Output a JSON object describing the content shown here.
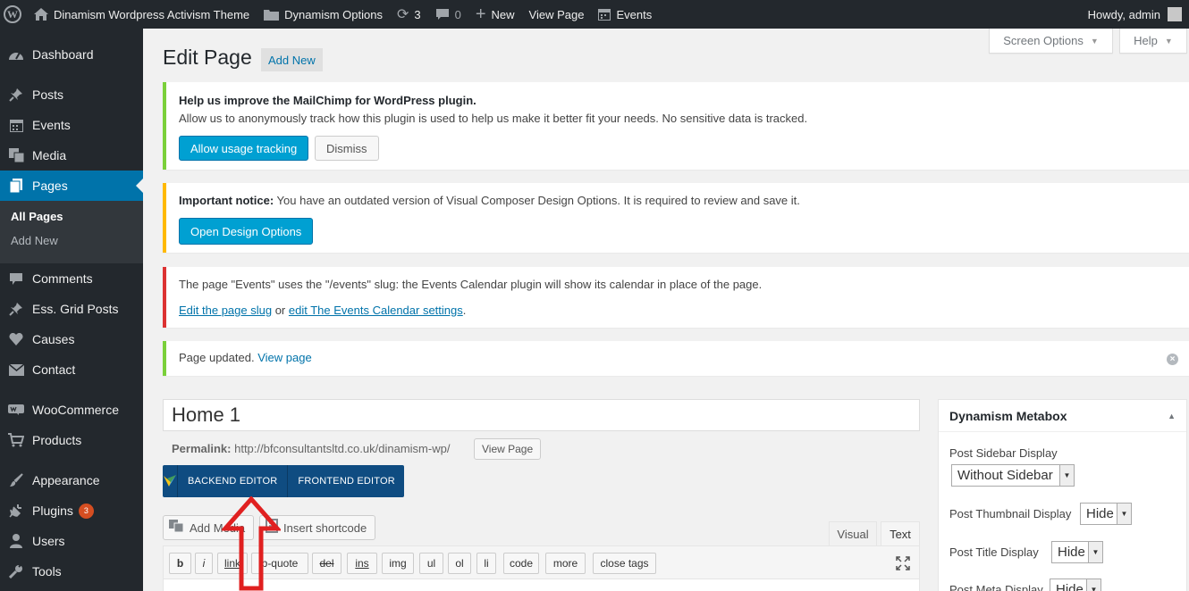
{
  "admin_bar": {
    "site_name": "Dinamism Wordpress Activism Theme",
    "options_label": "Dynamism Options",
    "updates_count": "3",
    "comments_count": "0",
    "new_label": "New",
    "view_page_label": "View Page",
    "events_label": "Events",
    "howdy": "Howdy, admin"
  },
  "sidebar": {
    "items": [
      {
        "label": "Dashboard",
        "icon": "dashboard-icon"
      },
      {
        "label": "Posts",
        "icon": "pin-icon"
      },
      {
        "label": "Events",
        "icon": "calendar-icon"
      },
      {
        "label": "Media",
        "icon": "media-icon"
      },
      {
        "label": "Pages",
        "icon": "pages-icon"
      },
      {
        "label": "Comments",
        "icon": "comments-icon"
      },
      {
        "label": "Ess. Grid Posts",
        "icon": "pin-icon"
      },
      {
        "label": "Causes",
        "icon": "heart-icon"
      },
      {
        "label": "Contact",
        "icon": "mail-icon"
      },
      {
        "label": "WooCommerce",
        "icon": "woocommerce-icon"
      },
      {
        "label": "Products",
        "icon": "cart-icon"
      },
      {
        "label": "Appearance",
        "icon": "brush-icon"
      },
      {
        "label": "Plugins",
        "icon": "plug-icon",
        "badge": "3"
      },
      {
        "label": "Users",
        "icon": "user-icon"
      },
      {
        "label": "Tools",
        "icon": "wrench-icon"
      }
    ],
    "submenu": [
      "All Pages",
      "Add New"
    ]
  },
  "screen_options": "Screen Options",
  "help": "Help",
  "page": {
    "title": "Edit Page",
    "add_new": "Add New"
  },
  "notices": {
    "mailchimp": {
      "heading": "Help us improve the MailChimp for WordPress plugin.",
      "body": "Allow us to anonymously track how this plugin is used to help us make it better fit your needs. No sensitive data is tracked.",
      "allow_btn": "Allow usage tracking",
      "dismiss_btn": "Dismiss"
    },
    "vc": {
      "strong": "Important notice:",
      "body": " You have an outdated version of Visual Composer Design Options. It is required to review and save it.",
      "button": "Open Design Options"
    },
    "events": {
      "body": "The page \"Events\" uses the \"/events\" slug: the Events Calendar plugin will show its calendar in place of the page.",
      "link1": "Edit the page slug",
      "or": " or ",
      "link2": "edit The Events Calendar settings",
      "end": "."
    },
    "updated": {
      "body": "Page updated. ",
      "link": "View page"
    }
  },
  "editor": {
    "title_value": "Home 1",
    "permalink_label": "Permalink:",
    "permalink_url": " http://bfconsultantsltd.co.uk/dinamism-wp/",
    "view_page_btn": "View Page",
    "backend_editor": "BACKEND EDITOR",
    "frontend_editor": "FRONTEND EDITOR",
    "add_media": "Add Media",
    "insert_shortcode": "Insert shortcode",
    "tab_visual": "Visual",
    "tab_text": "Text",
    "quicktags": [
      "b",
      "i",
      "link",
      "b-quote",
      "del",
      "ins",
      "img",
      "ul",
      "ol",
      "li",
      "code",
      "more",
      "close tags"
    ]
  },
  "metabox": {
    "title": "Dynamism Metabox",
    "sidebar_label": "Post Sidebar Display",
    "sidebar_value": "Without Sidebar",
    "thumb_label": "Post Thumbnail Display",
    "thumb_value": "Hide",
    "title_label": "Post Title Display",
    "title_value": "Hide",
    "meta_label": "Post Meta Display",
    "meta_value": "Hide"
  },
  "colors": {
    "admin_bar": "#23282d",
    "accent": "#0073aa",
    "primary_button": "#00a0d2",
    "vc_bar": "#0f4c81",
    "success": "#7ad03a",
    "warning": "#ffb900",
    "error": "#dc3232",
    "annotation_arrow": "#e02020"
  }
}
